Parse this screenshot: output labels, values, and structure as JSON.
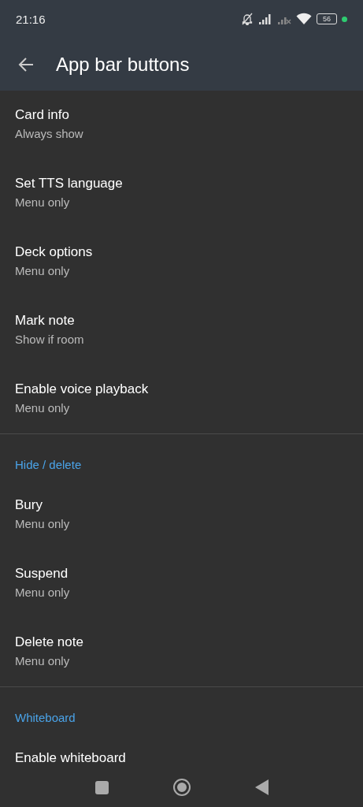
{
  "status_bar": {
    "time": "21:16",
    "battery": "56"
  },
  "app_bar": {
    "title": "App bar buttons"
  },
  "sections": [
    {
      "items": [
        {
          "title": "Card info",
          "summary": "Always show"
        },
        {
          "title": "Set TTS language",
          "summary": "Menu only"
        },
        {
          "title": "Deck options",
          "summary": "Menu only"
        },
        {
          "title": "Mark note",
          "summary": "Show if room"
        },
        {
          "title": "Enable voice playback",
          "summary": "Menu only"
        }
      ]
    },
    {
      "header": "Hide / delete",
      "items": [
        {
          "title": "Bury",
          "summary": "Menu only"
        },
        {
          "title": "Suspend",
          "summary": "Menu only"
        },
        {
          "title": "Delete note",
          "summary": "Menu only"
        }
      ]
    },
    {
      "header": "Whiteboard",
      "items": [
        {
          "title": "Enable whiteboard"
        }
      ]
    }
  ]
}
